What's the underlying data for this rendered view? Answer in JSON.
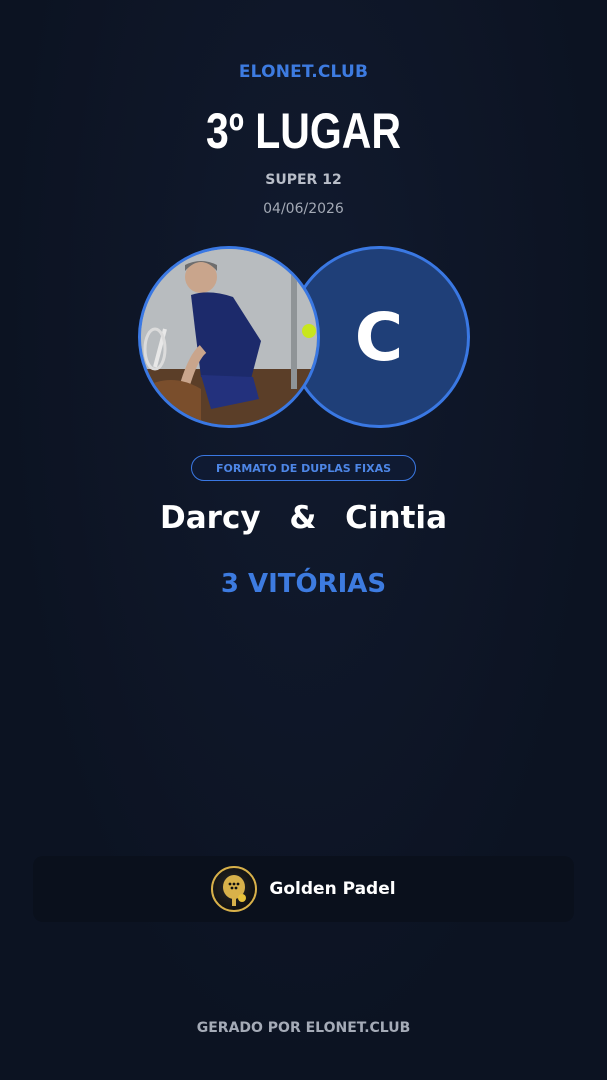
{
  "brand": "ELONET.CLUB",
  "placement": "3º LUGAR",
  "event": "SUPER 12",
  "date": "04/06/2026",
  "players": {
    "player1": {
      "name": "Darcy",
      "avatar": "player-photo"
    },
    "player2": {
      "name": "Cintia",
      "initial": "C"
    },
    "separator": "&"
  },
  "format_badge": "FORMATO DE DUPLAS FIXAS",
  "wins": "3 VITÓRIAS",
  "club": {
    "name": "Golden Padel",
    "logo": "golden-padel-logo"
  },
  "footer": "GERADO POR ELONET.CLUB",
  "colors": {
    "accent": "#3d7be0",
    "background": "#0d1424",
    "avatar_bg": "#1f3f78"
  }
}
